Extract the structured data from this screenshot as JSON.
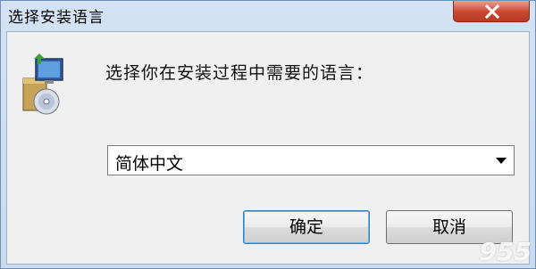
{
  "window": {
    "title": "选择安装语言"
  },
  "dialog": {
    "prompt": "选择你在安装过程中需要的语言：",
    "language_select": {
      "selected": "简体中文"
    },
    "ok_label": "确定",
    "cancel_label": "取消"
  },
  "icons": {
    "setup": "setup-installer-icon",
    "close": "close-icon",
    "dropdown": "dropdown-arrow-icon"
  },
  "watermark": {
    "text": "955"
  },
  "colors": {
    "close_button": "#c8472f",
    "default_button_border": "#3c7fb1"
  }
}
